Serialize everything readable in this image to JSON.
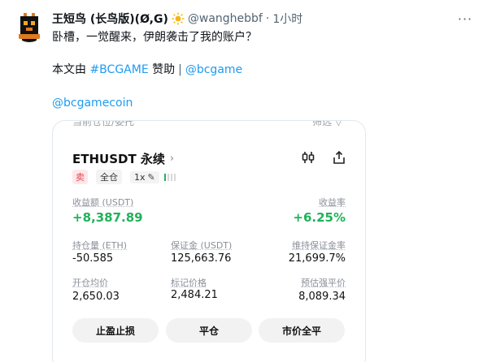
{
  "tweet": {
    "display_name": "王短鸟 (长鸟版)(Ø,G)",
    "handle": "@wanghebbf",
    "separator": "·",
    "time": "1小时",
    "more_label": "···",
    "line1": "卧槽，一觉醒来，伊朗袭击了我的账户？",
    "line2_prefix": "本文由 ",
    "line2_hashtag": "#BCGAME",
    "line2_middle": " 赞助",
    "line2_sep": "|",
    "line2_mention": "@bcgame",
    "line3_mention": "@bcgamecoin"
  },
  "card": {
    "top_ghost_left": "当前仓位/委托",
    "top_ghost_right": "筛选  ▽",
    "pair": "ETHUSDT 永续",
    "pair_chevron": "›",
    "tags": {
      "side": "卖",
      "margin_mode": "全仓",
      "leverage": "1x",
      "pencil": "✎"
    },
    "pnl_label": "收益额 (USDT)",
    "pnl_value": "+8,387.89",
    "roe_label": "收益率",
    "roe_value": "+6.25%",
    "size_label": "持仓量 (ETH)",
    "size_value": "-50.585",
    "margin_label": "保证金 (USDT)",
    "margin_value": "125,663.76",
    "mm_label": "维持保证金率",
    "mm_value": "21,699.7%",
    "entry_label": "开仓均价",
    "entry_value": "2,650.03",
    "mark_label": "标记价格",
    "mark_value": "2,484.21",
    "liq_label": "预估强平价",
    "liq_value": "8,089.34",
    "btn_tpsl": "止盈止损",
    "btn_close": "平仓",
    "btn_market_close": "市价全平",
    "accent_green": "#21b15a",
    "accent_red": "#e0474f"
  }
}
